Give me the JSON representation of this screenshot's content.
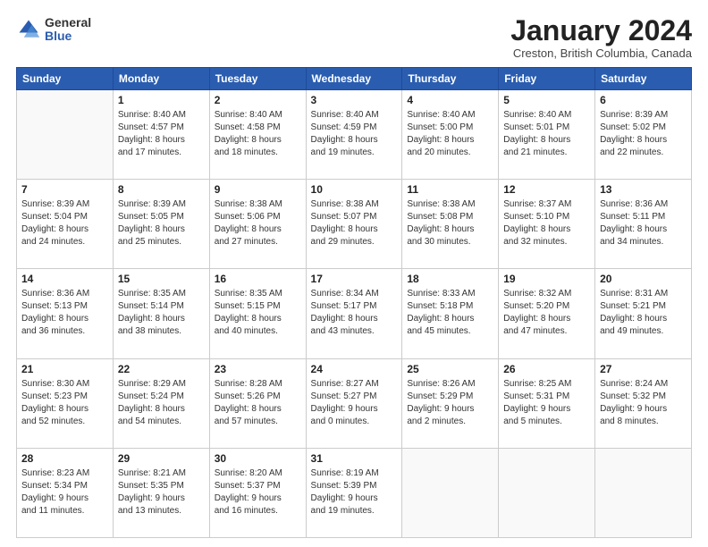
{
  "header": {
    "logo_general": "General",
    "logo_blue": "Blue",
    "month_title": "January 2024",
    "location": "Creston, British Columbia, Canada"
  },
  "days_of_week": [
    "Sunday",
    "Monday",
    "Tuesday",
    "Wednesday",
    "Thursday",
    "Friday",
    "Saturday"
  ],
  "weeks": [
    [
      {
        "day": "",
        "info": ""
      },
      {
        "day": "1",
        "info": "Sunrise: 8:40 AM\nSunset: 4:57 PM\nDaylight: 8 hours\nand 17 minutes."
      },
      {
        "day": "2",
        "info": "Sunrise: 8:40 AM\nSunset: 4:58 PM\nDaylight: 8 hours\nand 18 minutes."
      },
      {
        "day": "3",
        "info": "Sunrise: 8:40 AM\nSunset: 4:59 PM\nDaylight: 8 hours\nand 19 minutes."
      },
      {
        "day": "4",
        "info": "Sunrise: 8:40 AM\nSunset: 5:00 PM\nDaylight: 8 hours\nand 20 minutes."
      },
      {
        "day": "5",
        "info": "Sunrise: 8:40 AM\nSunset: 5:01 PM\nDaylight: 8 hours\nand 21 minutes."
      },
      {
        "day": "6",
        "info": "Sunrise: 8:39 AM\nSunset: 5:02 PM\nDaylight: 8 hours\nand 22 minutes."
      }
    ],
    [
      {
        "day": "7",
        "info": "Sunrise: 8:39 AM\nSunset: 5:04 PM\nDaylight: 8 hours\nand 24 minutes."
      },
      {
        "day": "8",
        "info": "Sunrise: 8:39 AM\nSunset: 5:05 PM\nDaylight: 8 hours\nand 25 minutes."
      },
      {
        "day": "9",
        "info": "Sunrise: 8:38 AM\nSunset: 5:06 PM\nDaylight: 8 hours\nand 27 minutes."
      },
      {
        "day": "10",
        "info": "Sunrise: 8:38 AM\nSunset: 5:07 PM\nDaylight: 8 hours\nand 29 minutes."
      },
      {
        "day": "11",
        "info": "Sunrise: 8:38 AM\nSunset: 5:08 PM\nDaylight: 8 hours\nand 30 minutes."
      },
      {
        "day": "12",
        "info": "Sunrise: 8:37 AM\nSunset: 5:10 PM\nDaylight: 8 hours\nand 32 minutes."
      },
      {
        "day": "13",
        "info": "Sunrise: 8:36 AM\nSunset: 5:11 PM\nDaylight: 8 hours\nand 34 minutes."
      }
    ],
    [
      {
        "day": "14",
        "info": "Sunrise: 8:36 AM\nSunset: 5:13 PM\nDaylight: 8 hours\nand 36 minutes."
      },
      {
        "day": "15",
        "info": "Sunrise: 8:35 AM\nSunset: 5:14 PM\nDaylight: 8 hours\nand 38 minutes."
      },
      {
        "day": "16",
        "info": "Sunrise: 8:35 AM\nSunset: 5:15 PM\nDaylight: 8 hours\nand 40 minutes."
      },
      {
        "day": "17",
        "info": "Sunrise: 8:34 AM\nSunset: 5:17 PM\nDaylight: 8 hours\nand 43 minutes."
      },
      {
        "day": "18",
        "info": "Sunrise: 8:33 AM\nSunset: 5:18 PM\nDaylight: 8 hours\nand 45 minutes."
      },
      {
        "day": "19",
        "info": "Sunrise: 8:32 AM\nSunset: 5:20 PM\nDaylight: 8 hours\nand 47 minutes."
      },
      {
        "day": "20",
        "info": "Sunrise: 8:31 AM\nSunset: 5:21 PM\nDaylight: 8 hours\nand 49 minutes."
      }
    ],
    [
      {
        "day": "21",
        "info": "Sunrise: 8:30 AM\nSunset: 5:23 PM\nDaylight: 8 hours\nand 52 minutes."
      },
      {
        "day": "22",
        "info": "Sunrise: 8:29 AM\nSunset: 5:24 PM\nDaylight: 8 hours\nand 54 minutes."
      },
      {
        "day": "23",
        "info": "Sunrise: 8:28 AM\nSunset: 5:26 PM\nDaylight: 8 hours\nand 57 minutes."
      },
      {
        "day": "24",
        "info": "Sunrise: 8:27 AM\nSunset: 5:27 PM\nDaylight: 9 hours\nand 0 minutes."
      },
      {
        "day": "25",
        "info": "Sunrise: 8:26 AM\nSunset: 5:29 PM\nDaylight: 9 hours\nand 2 minutes."
      },
      {
        "day": "26",
        "info": "Sunrise: 8:25 AM\nSunset: 5:31 PM\nDaylight: 9 hours\nand 5 minutes."
      },
      {
        "day": "27",
        "info": "Sunrise: 8:24 AM\nSunset: 5:32 PM\nDaylight: 9 hours\nand 8 minutes."
      }
    ],
    [
      {
        "day": "28",
        "info": "Sunrise: 8:23 AM\nSunset: 5:34 PM\nDaylight: 9 hours\nand 11 minutes."
      },
      {
        "day": "29",
        "info": "Sunrise: 8:21 AM\nSunset: 5:35 PM\nDaylight: 9 hours\nand 13 minutes."
      },
      {
        "day": "30",
        "info": "Sunrise: 8:20 AM\nSunset: 5:37 PM\nDaylight: 9 hours\nand 16 minutes."
      },
      {
        "day": "31",
        "info": "Sunrise: 8:19 AM\nSunset: 5:39 PM\nDaylight: 9 hours\nand 19 minutes."
      },
      {
        "day": "",
        "info": ""
      },
      {
        "day": "",
        "info": ""
      },
      {
        "day": "",
        "info": ""
      }
    ]
  ]
}
